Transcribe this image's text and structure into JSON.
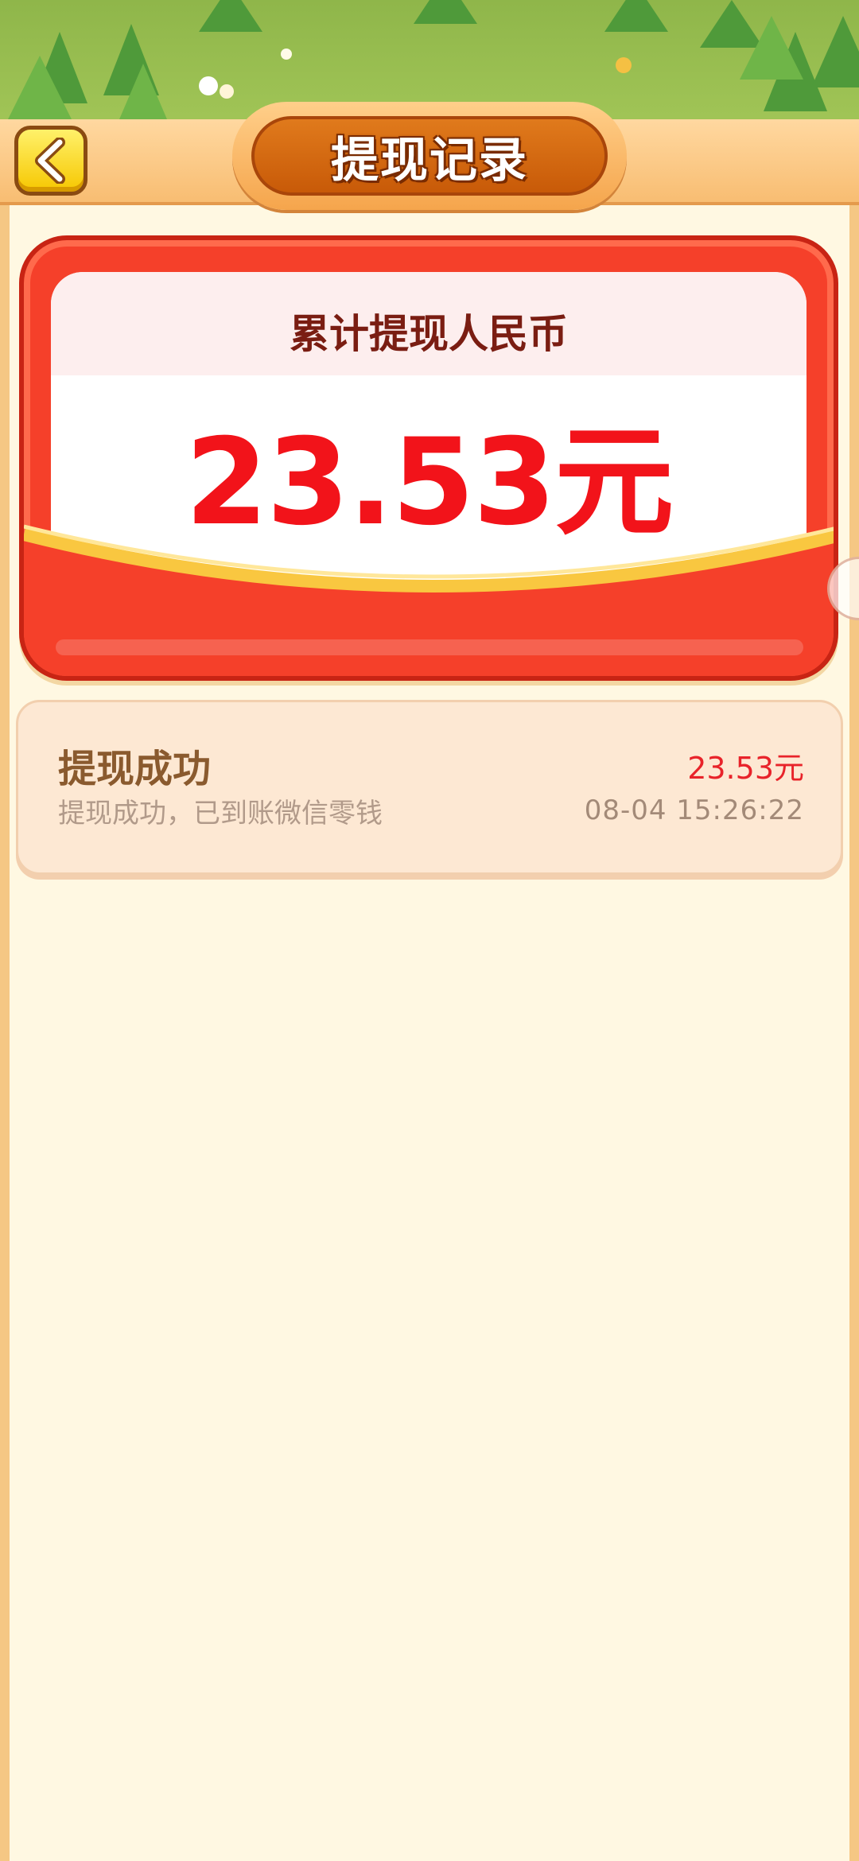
{
  "header": {
    "title": "提现记录",
    "back_icon": "chevron-left-icon"
  },
  "summary": {
    "label": "累计提现人民币",
    "amount": "23.53元"
  },
  "records": [
    {
      "title": "提现成功",
      "description": "提现成功，已到账微信零钱",
      "amount": "23.53元",
      "time": "08-04  15:26:22"
    }
  ],
  "colors": {
    "accent_red": "#f2131a",
    "header_orange": "#c85a08",
    "back_button_yellow": "#f6c700",
    "background_cream": "#fff8e2"
  }
}
